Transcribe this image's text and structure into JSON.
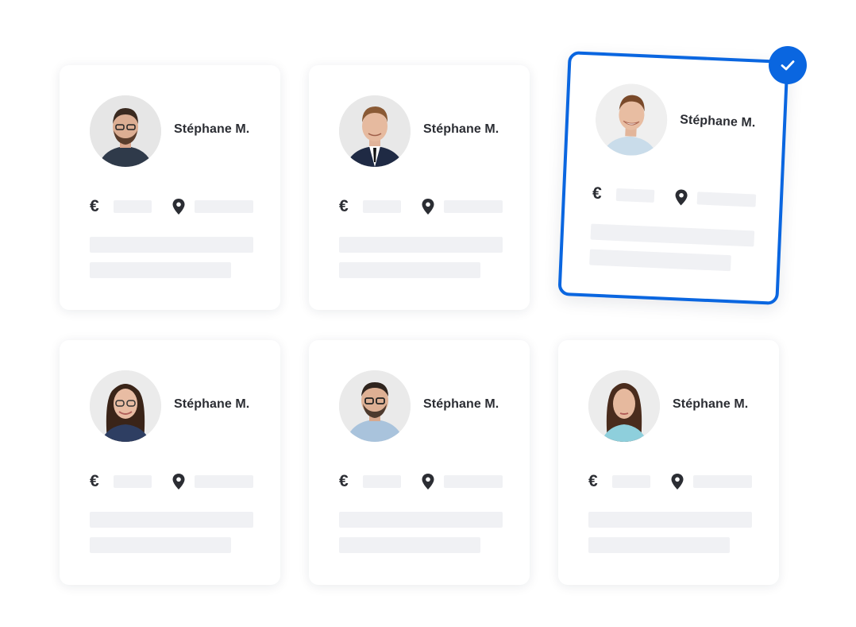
{
  "cards": [
    {
      "name": "Stéphane M.",
      "avatar": "man-glasses-beard-portrait",
      "selected": false
    },
    {
      "name": "Stéphane M.",
      "avatar": "man-suit-tie-portrait",
      "selected": false
    },
    {
      "name": "Stéphane M.",
      "avatar": "man-smiling-portrait",
      "selected": true
    },
    {
      "name": "Stéphane M.",
      "avatar": "woman-glasses-portrait",
      "selected": false
    },
    {
      "name": "Stéphane M.",
      "avatar": "man-glasses-shirt-portrait",
      "selected": false
    },
    {
      "name": "Stéphane M.",
      "avatar": "woman-long-hair-portrait",
      "selected": false
    }
  ],
  "icons": {
    "salary": "euro-icon",
    "salary_glyph": "€",
    "location": "location-pin-icon",
    "selected_badge": "checkmark-icon"
  },
  "colors": {
    "accent": "#0a66e0",
    "text": "#2b2d33",
    "placeholder": "#f0f1f4"
  }
}
